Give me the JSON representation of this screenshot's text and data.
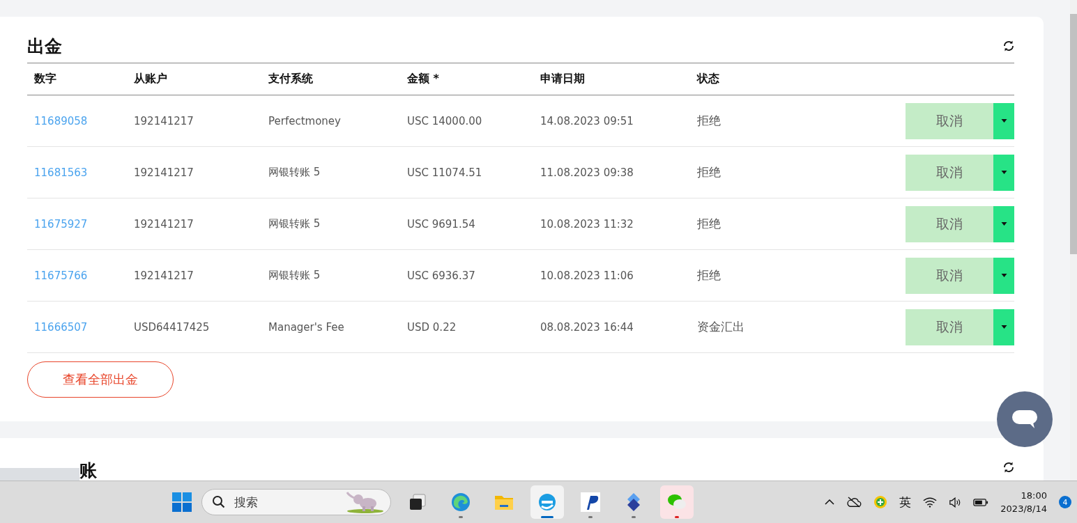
{
  "withdrawals": {
    "title": "出金",
    "columns": [
      "数字",
      "从账户",
      "支付系统",
      "金额 *",
      "申请日期",
      "状态"
    ],
    "rows": [
      {
        "number": "11689058",
        "account": "192141217",
        "system": "Perfectmoney",
        "amount": "USC 14000.00",
        "date": "14.08.2023 09:51",
        "status": "拒绝",
        "action": "取消"
      },
      {
        "number": "11681563",
        "account": "192141217",
        "system": "网银转账 5",
        "amount": "USC 11074.51",
        "date": "11.08.2023 09:38",
        "status": "拒绝",
        "action": "取消"
      },
      {
        "number": "11675927",
        "account": "192141217",
        "system": "网银转账 5",
        "amount": "USC 9691.54",
        "date": "10.08.2023 11:32",
        "status": "拒绝",
        "action": "取消"
      },
      {
        "number": "11675766",
        "account": "192141217",
        "system": "网银转账 5",
        "amount": "USC 6936.37",
        "date": "10.08.2023 11:06",
        "status": "拒绝",
        "action": "取消"
      },
      {
        "number": "11666507",
        "account": "USD64417425",
        "system": "Manager's Fee",
        "amount": "USD 0.22",
        "date": "08.08.2023 16:44",
        "status": "资金汇出",
        "action": "取消"
      }
    ],
    "view_all": "查看全部出金"
  },
  "transfers": {
    "title": "账"
  },
  "taskbar": {
    "search": {
      "placeholder": "搜索"
    },
    "apps": [
      {
        "kind": "taskview",
        "selected": false,
        "open": false,
        "attention": false
      },
      {
        "kind": "edge",
        "selected": false,
        "open": true,
        "attention": false
      },
      {
        "kind": "folder",
        "selected": false,
        "open": false,
        "attention": false
      },
      {
        "kind": "browser",
        "selected": true,
        "open": true,
        "attention": false
      },
      {
        "kind": "p",
        "selected": false,
        "open": true,
        "attention": false
      },
      {
        "kind": "diamond",
        "selected": false,
        "open": true,
        "attention": false
      },
      {
        "kind": "chat",
        "selected": false,
        "open": true,
        "attention": true
      }
    ],
    "ime": "英",
    "time": "18:00",
    "date": "2023/8/14",
    "notifications": "4"
  }
}
